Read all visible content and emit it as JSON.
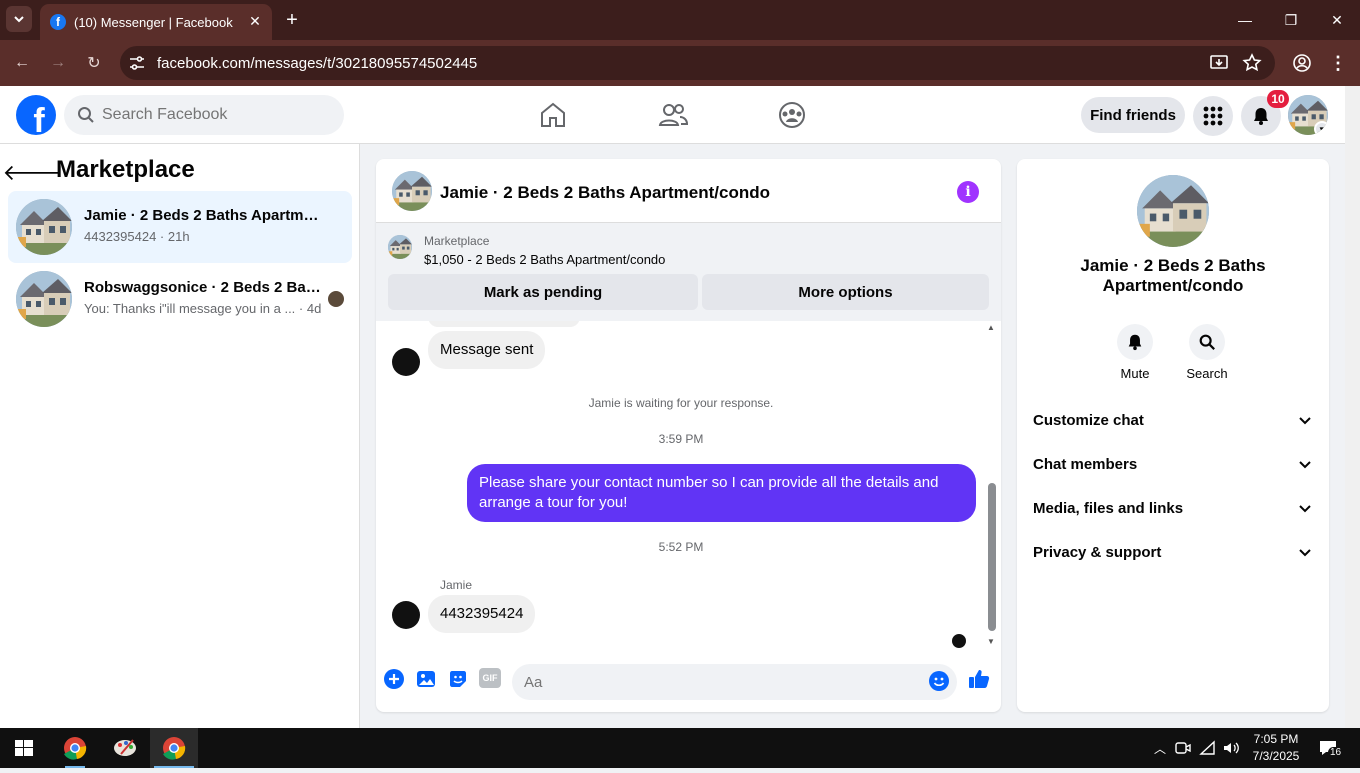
{
  "browser": {
    "tab_title": "(10) Messenger | Facebook",
    "url": "facebook.com/messages/t/30218095574502445"
  },
  "header": {
    "search_placeholder": "Search Facebook",
    "find_friends_label": "Find friends",
    "notification_count": "10"
  },
  "left_panel": {
    "title": "Marketplace",
    "conversations": [
      {
        "name": "Jamie · 2 Beds 2 Baths Apartment/condo",
        "preview": "4432395424 · 21h"
      },
      {
        "name": "Robswaggsonice · 2 Beds 2 Baths Apartment/condo",
        "preview": "You: Thanks i\"ill message you in a ... · 4d"
      }
    ]
  },
  "chat": {
    "title": "Jamie · 2 Beds 2 Baths Apartment/condo",
    "banner": {
      "label": "Marketplace",
      "item": "$1,050 - 2 Beds 2 Baths Apartment/condo",
      "mark_pending": "Mark as pending",
      "more_options": "More options"
    },
    "messages": {
      "sent_notice": "Message sent",
      "waiting": "Jamie is waiting for your response.",
      "time1": "3:59 PM",
      "outgoing": "Please share your contact number so I can provide all the details and arrange a tour for you!",
      "time2": "5:52 PM",
      "sender": "Jamie",
      "incoming": "4432395424"
    },
    "composer_placeholder": "Aa",
    "gif_label": "GIF"
  },
  "right_panel": {
    "name": "Jamie · 2 Beds 2 Baths Apartment/condo",
    "mute_label": "Mute",
    "search_label": "Search",
    "sections": [
      "Customize chat",
      "Chat members",
      "Media, files and links",
      "Privacy & support"
    ]
  },
  "taskbar": {
    "time": "7:05 PM",
    "date": "7/3/2025",
    "notification_count": "16"
  },
  "colors": {
    "accent": "#0866ff",
    "outgoing_bubble": "#6134f5",
    "chrome_frame": "#3c1e1c"
  }
}
